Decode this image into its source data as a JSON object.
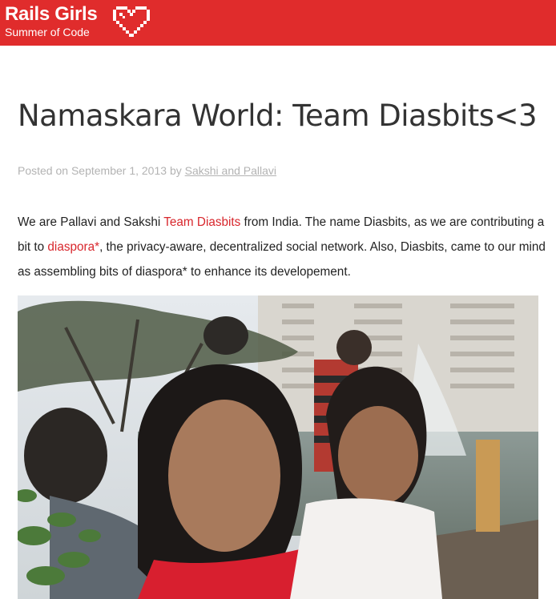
{
  "header": {
    "logo_name": "Rails Girls",
    "logo_subtitle": "Summer of Code",
    "brand_color": "#e02c2c",
    "heart_icon": "pixel-heart-icon"
  },
  "post": {
    "title": "Namaskara World: Team Diasbits<3",
    "meta": {
      "prefix": "Posted on",
      "date": "September 1, 2013",
      "by": "by",
      "author": "Sakshi and Pallavi"
    },
    "body": {
      "part1": "We are Pallavi and Sakshi ",
      "link_team": "Team Diasbits",
      "part2": " from India. The name Diasbits, as we are contributing a bit to ",
      "link_diaspora": "diaspora*",
      "part3": ", the privacy-aware, decentralized social network. Also, Diasbits, came to our mind as assembling bits of diaspora* to enhance its developement."
    },
    "link_color": "#d8262c"
  }
}
